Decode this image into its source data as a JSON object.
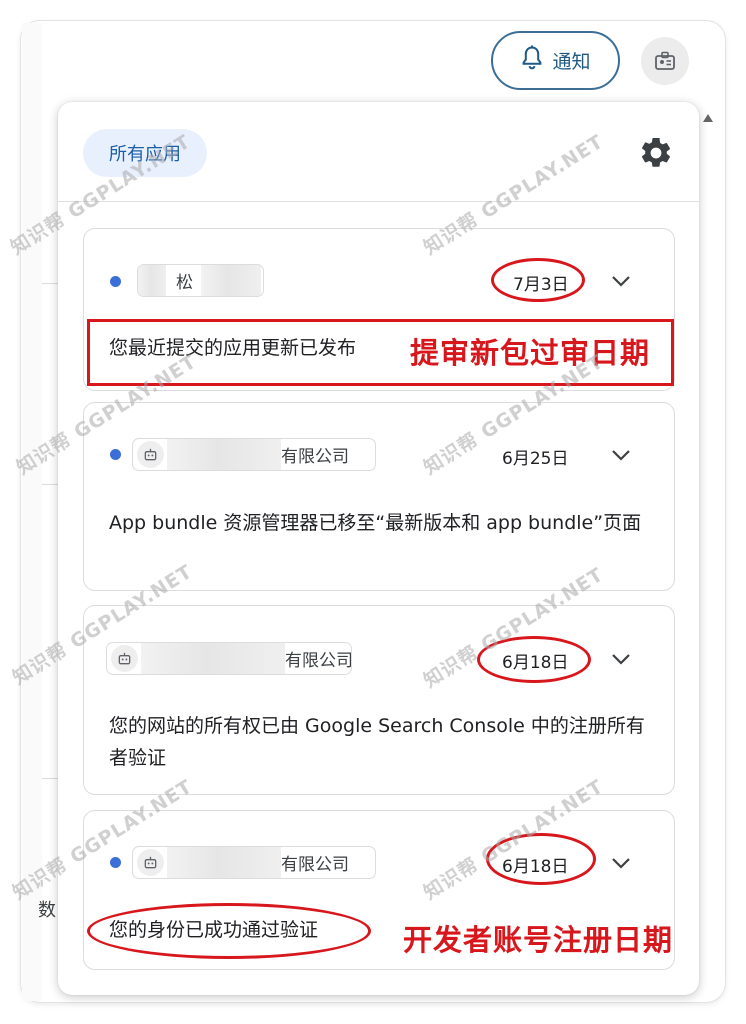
{
  "topbar": {
    "notify_label": "通知"
  },
  "panel": {
    "filter_label": "所有应用"
  },
  "notifications": [
    {
      "app_name": "松",
      "date": "7月3日",
      "message": "您最近提交的应用更新已发布",
      "unread": true
    },
    {
      "app_name": "有限公司",
      "date": "6月25日",
      "message": "App bundle 资源管理器已移至“最新版本和 app bundle”页面",
      "unread": true
    },
    {
      "app_name": "有限公司",
      "date": "6月18日",
      "message": "您的网站的所有权已由 Google Search Console 中的注册所有者验证",
      "unread": false
    },
    {
      "app_name": "有限公司",
      "date": "6月18日",
      "message": "您的身份已成功通过验证",
      "unread": true
    }
  ],
  "annotations": {
    "review_date": "提审新包过审日期",
    "register_date": "开发者账号注册日期"
  },
  "background": {
    "partial_text": "数"
  },
  "watermark": {
    "text": "知识帮  GGPLAY.NET"
  },
  "colors": {
    "accent_blue": "#3b6fd8",
    "chip_bg": "#e8f0fe",
    "annotation_red": "#d8171d"
  }
}
